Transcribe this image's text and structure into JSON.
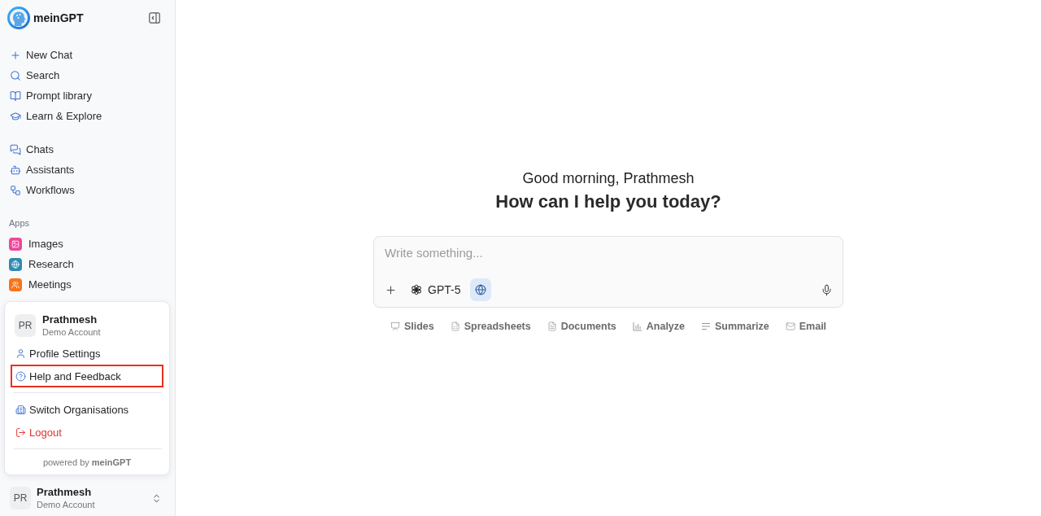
{
  "sidebar": {
    "brand": "meinGPT",
    "primary_items": [
      "New Chat",
      "Search",
      "Prompt library",
      "Learn & Explore"
    ],
    "secondary_items": [
      "Chats",
      "Assistants",
      "Workflows"
    ],
    "apps_heading": "Apps",
    "apps": [
      {
        "label": "Images",
        "color": "#ec4899"
      },
      {
        "label": "Research",
        "color": "#2f8ab3"
      },
      {
        "label": "Meetings",
        "color": "#f97316"
      }
    ],
    "account": {
      "initials": "PR",
      "name": "Prathmesh",
      "subtitle": "Demo Account"
    }
  },
  "account_menu": {
    "initials": "PR",
    "name": "Prathmesh",
    "subtitle": "Demo Account",
    "sections": [
      {
        "items": [
          {
            "label": "Profile Settings",
            "kind": "normal",
            "highlighted": false
          },
          {
            "label": "Help and Feedback",
            "kind": "normal",
            "highlighted": true
          }
        ]
      },
      {
        "items": [
          {
            "label": "Switch Organisations",
            "kind": "normal",
            "highlighted": false
          },
          {
            "label": "Logout",
            "kind": "danger",
            "highlighted": false
          }
        ]
      }
    ],
    "footer": "powered by **meinGPT**"
  },
  "main": {
    "greeting": "Good morning, Prathmesh",
    "headline": "How can I help you today?",
    "composer": {
      "placeholder": "Write something...",
      "model": "GPT-5",
      "web_search_on": true
    },
    "quick_actions": [
      "Slides",
      "Spreadsheets",
      "Documents",
      "Analyze",
      "Summarize",
      "Email"
    ]
  }
}
